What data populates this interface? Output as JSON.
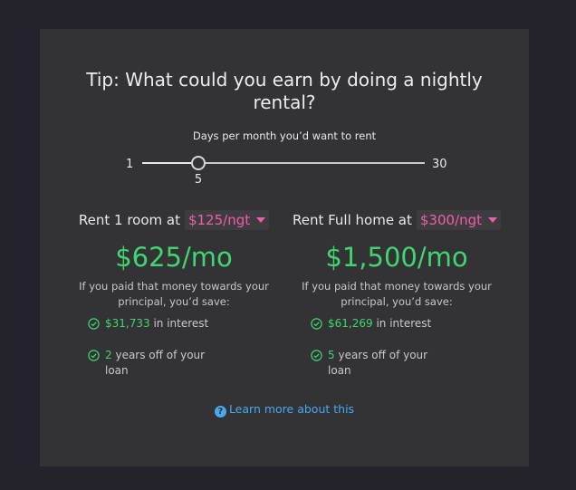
{
  "title": "Tip: What could you earn by doing a nightly rental?",
  "slider": {
    "label": "Days per month you’d want to rent",
    "min_label": "1",
    "max_label": "30",
    "min": 1,
    "max": 30,
    "value": 5,
    "value_label": "5"
  },
  "room": {
    "prefix": "Rent 1 room at",
    "rate": "$125/ngt",
    "monthly": "$625/mo",
    "save_text": "If you paid that money towards your principal, you’d save:",
    "interest_value": "$31,733",
    "interest_suffix": "in interest",
    "years_value": "2",
    "years_suffix": "years off of your loan"
  },
  "home": {
    "prefix": "Rent Full home at",
    "rate": "$300/ngt",
    "monthly": "$1,500/mo",
    "save_text": "If you paid that money towards your principal, you’d save:",
    "interest_value": "$61,269",
    "interest_suffix": "in interest",
    "years_value": "5",
    "years_suffix": "years off of your loan"
  },
  "learn_more": "Learn more about this",
  "icons": {
    "check": "check-circle-icon",
    "help": "question-circle-icon",
    "caret": "caret-down-icon"
  },
  "colors": {
    "background": "#24222a",
    "card": "#333335",
    "accent_green": "#3fd570",
    "accent_pink": "#ee5fa4",
    "link_blue": "#47a9ee"
  }
}
